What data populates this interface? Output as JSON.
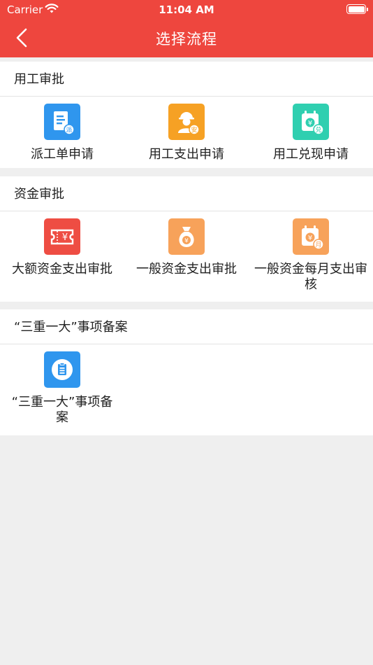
{
  "status_bar": {
    "carrier": "Carrier",
    "time": "11:04 AM"
  },
  "nav": {
    "title": "选择流程"
  },
  "sections": [
    {
      "title": "用工审批",
      "items": [
        {
          "label": "派工单申请",
          "icon": "dispatch-form-icon",
          "color": "#2f96ee"
        },
        {
          "label": "用工支出申请",
          "icon": "worker-expense-icon",
          "color": "#f6a124"
        },
        {
          "label": "用工兑现申请",
          "icon": "worker-cashout-icon",
          "color": "#2fcfb0"
        }
      ]
    },
    {
      "title": "资金审批",
      "items": [
        {
          "label": "大额资金支出审批",
          "icon": "large-fund-ticket-icon",
          "color": "#ee4d43"
        },
        {
          "label": "一般资金支出审批",
          "icon": "money-bag-icon",
          "color": "#f7a25a"
        },
        {
          "label": "一般资金每月支出审核",
          "icon": "monthly-calendar-icon",
          "color": "#f7a25a"
        }
      ]
    },
    {
      "title": "“三重一大”事项备案",
      "items": [
        {
          "label": "“三重一大”事项备案",
          "icon": "document-record-icon",
          "color": "#2f96ee"
        }
      ]
    }
  ],
  "icon_badges": {
    "dispatch": "派",
    "worker": "安",
    "cashout": "兑",
    "yen": "¥",
    "month": "月"
  }
}
